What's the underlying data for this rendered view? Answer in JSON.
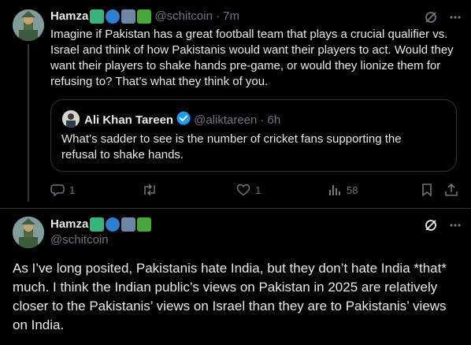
{
  "colors": {
    "background": "#000000",
    "text": "#e7e9ea",
    "muted": "#71767b",
    "border": "#2f3336",
    "verified": "#1d9bf0"
  },
  "reply_tweet": {
    "author_name": "Hamza",
    "author_emojis": [
      "badge-emoji",
      "globe-emoji",
      "city-emoji",
      "check-emoji"
    ],
    "handle": "@schitcoin",
    "time": "· 7m",
    "text": "Imagine if Pakistan has a great football team that plays a crucial qualifier vs. Israel and think of how Pakistanis would want their players to act. Would they want their players to shake hands pre-game, or would they lionize them for refusing to? That’s what they think of you.",
    "quote": {
      "author_name": "Ali Khan Tareen",
      "handle": "@aliktareen",
      "time": "· 6h",
      "text": "What’s sadder to see is the number of cricket fans supporting the refusal to shake hands."
    },
    "actions": {
      "replies": "1",
      "retweets": "",
      "likes": "1",
      "views": "58"
    }
  },
  "main_tweet": {
    "author_name": "Hamza",
    "handle": "@schitcoin",
    "text": "As I’ve long posited, Pakistanis hate India, but they don’t hate India *that* much. I think the Indian public’s views on Pakistan in 2025 are relatively closer to the Pakistanis’ views on Israel than they are to Pakistanis’ views on India."
  }
}
